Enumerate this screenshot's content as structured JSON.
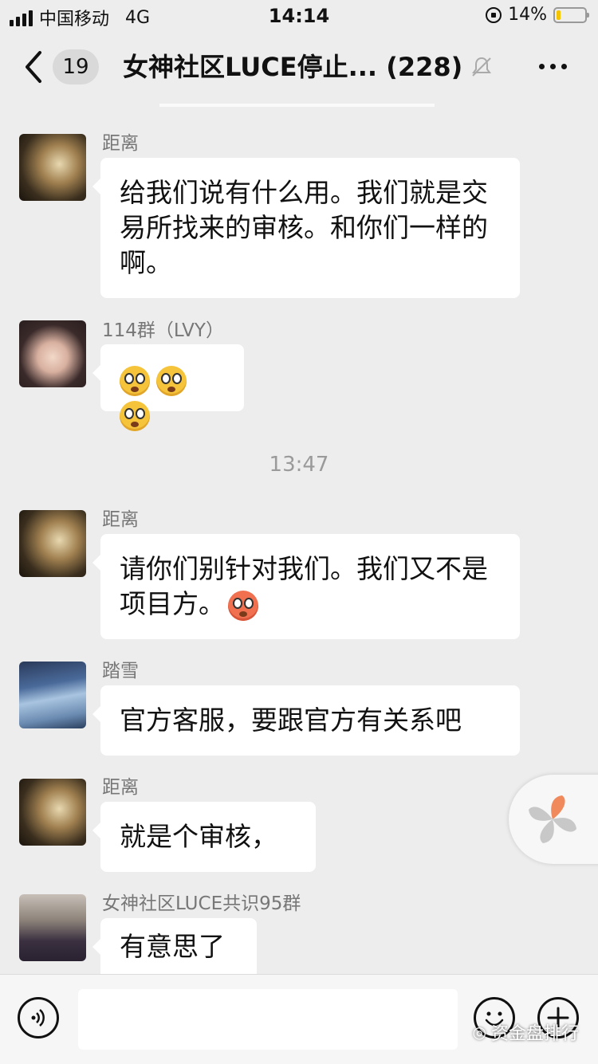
{
  "status_bar": {
    "carrier": "中国移动",
    "network": "4G",
    "time": "14:14",
    "battery_percent": "14%",
    "battery_level": 0.14
  },
  "nav": {
    "back_badge": "19",
    "title": "女神社区LUCE停止... (228)"
  },
  "messages": [
    {
      "sender": "距离",
      "text": "给我们说有什么用。我们就是交易所找来的审核。和你们一样的啊。"
    },
    {
      "sender": "114群（LVY）",
      "text": ""
    },
    {
      "sender": "距离",
      "text": "请你们别针对我们。我们又不是项目方。"
    },
    {
      "sender": "踏雪",
      "text": "官方客服，要跟官方有关系吧"
    },
    {
      "sender": "距离",
      "text": "就是个审核，"
    },
    {
      "sender": "女神社区LUCE共识95群",
      "text": "有意思了"
    }
  ],
  "timestamp": "13:47",
  "watermark": "资金盘排行",
  "colors": {
    "background": "#ededed",
    "bubble": "#ffffff",
    "emoji_yellow": "#f5c43a",
    "battery_fill": "#f5c400"
  },
  "icons": [
    "back-chevron-icon",
    "mute-bell-icon",
    "more-dots-icon",
    "voice-icon",
    "emoji-icon",
    "plus-icon",
    "float-pinwheel-icon"
  ]
}
